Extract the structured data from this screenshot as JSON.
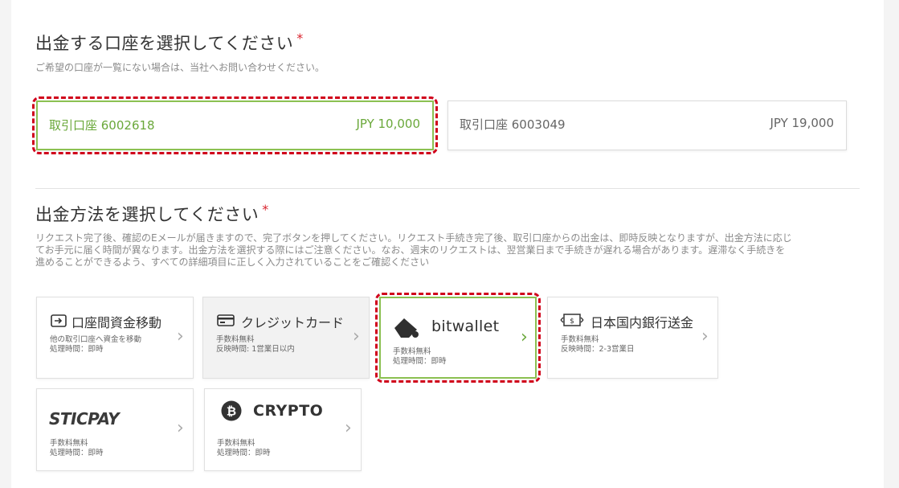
{
  "account_section": {
    "title": "出金する口座を選択してください",
    "required_mark": "*",
    "subtitle": "ご希望の口座が一覧にない場合は、当社へお問い合わせください。",
    "accounts": [
      {
        "name": "取引口座 6002618",
        "balance": "JPY 10,000",
        "selected": true
      },
      {
        "name": "取引口座 6003049",
        "balance": "JPY 19,000",
        "selected": false
      }
    ]
  },
  "method_section": {
    "title": "出金方法を選択してください",
    "required_mark": "*",
    "description_lines": [
      "リクエスト完了後、確認のEメールが届きますので、完了ボタンを押してください。リクエスト手続き完了後、取引口座からの出金は、即時反映となりますが、出金方法に応じ",
      "てお手元に届く時間が異なります。出金方法を選択する際にはご注意ください。なお、週末のリクエストは、翌営業日まで手続きが遅れる場合があります。遅滞なく手続きを",
      "進めることができるよう、すべての詳細項目に正しく入力されていることをご確認ください"
    ],
    "methods": [
      {
        "title": "口座間資金移動",
        "line1": "他の取引口座へ資金を移動",
        "line2": "処理時間：即時",
        "icon": "transfer-icon"
      },
      {
        "title": "クレジットカード",
        "line1": "手数料無料",
        "line2": "反映時間: 1営業日以内",
        "icon": "credit-card-icon"
      },
      {
        "title": "bitwallet",
        "line1": "手数料無料",
        "line2": "処理時間：即時",
        "icon": "bitwallet-logo",
        "selected": true
      },
      {
        "title": "日本国内銀行送金",
        "line1": "手数料無料",
        "line2": "反映時間：2-3営業日",
        "icon": "banknote-icon"
      },
      {
        "title": "STICPAY",
        "line1": "手数料無料",
        "line2": "処理時間：即時",
        "icon": "sticpay-logo"
      },
      {
        "title": "CRYPTO",
        "line1": "手数料無料",
        "line2": "処理時間：即時",
        "icon": "bitcoin-icon"
      }
    ],
    "chevron": "›"
  },
  "colors": {
    "selected_green": "#8cc152",
    "highlight_red": "#d0021b",
    "required_red": "#d9232d"
  }
}
